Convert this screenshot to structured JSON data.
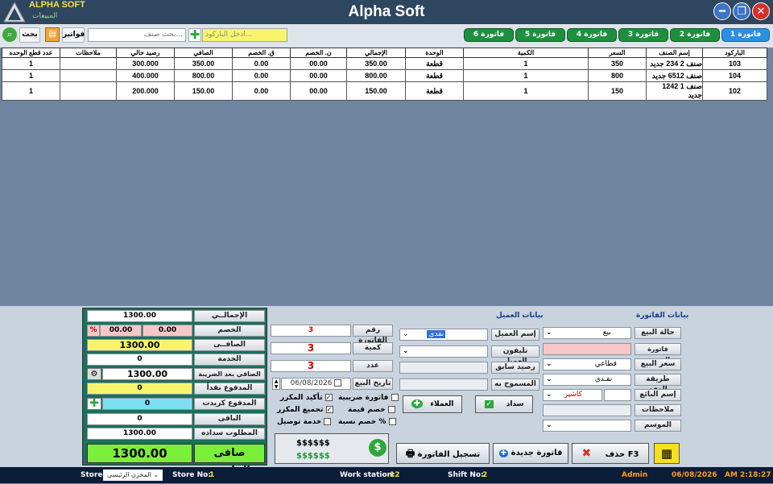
{
  "window": {
    "brand": "ALPHA SOFT",
    "brand_sub": "المبيعات",
    "title": "Alpha Soft"
  },
  "toolbar": {
    "search_label": "بحث",
    "invoices_label": "فواتير",
    "item_search_placeholder": "بحث صنف...",
    "barcode_placeholder": "ادخل الباركود..."
  },
  "tabs": [
    "فاتورة 1",
    "فاتورة 2",
    "فاتورة 3",
    "فاتورة 4",
    "فاتورة 5",
    "فاتورة 6"
  ],
  "table": {
    "headers": [
      "الباركود",
      "إسم الصنف",
      "السعر",
      "الكمية",
      "الوحدة",
      "الإجمالي",
      "ن. الخصم",
      "ق. الخصم",
      "الصافي",
      "رصيد حالي",
      "ملاحظات",
      "عدد قطع الوحده"
    ],
    "rows": [
      [
        "103",
        "صنف 2 234 جديد",
        "350",
        "1",
        "قطعة",
        "350.00",
        "00.00",
        "0.00",
        "350.00",
        "300.000",
        "",
        "1"
      ],
      [
        "104",
        "صنف 6512 جديد",
        "800",
        "1",
        "قطعة",
        "800.00",
        "00.00",
        "0.00",
        "800.00",
        "400.000",
        "",
        "1"
      ],
      [
        "102",
        "صنف 1 1242 جديد",
        "150",
        "1",
        "قطعة",
        "150.00",
        "00.00",
        "0.00",
        "150.00",
        "200.000",
        "",
        "1"
      ]
    ]
  },
  "totals": {
    "total_label": "الإجمالــي",
    "total": "1300.00",
    "discount_label": "الخصم",
    "discount_pct_sign": "%",
    "discount_a": "00.00",
    "discount_b": "0.00",
    "net_label": "الصافــى",
    "net": "1300.00",
    "service_label": "الخدمة",
    "service": "0",
    "after_tax_label": "الصافي بعد الضريبة",
    "after_tax": "1300.00",
    "paid_cash_label": "المدفوع نقداً",
    "paid_cash": "0",
    "paid_credit_label": "المدفوع كريدت",
    "paid_credit": "0",
    "remaining_label": "الباقى",
    "remaining": "0",
    "required_label": "المطلوب سداده",
    "required": "1300.00",
    "invoice_net_label": "صافى الفاتورة",
    "invoice_net": "1300.00"
  },
  "invoice_meta": {
    "number_label": "رقم الفاتورة",
    "number": "3",
    "qty_label": "كمية",
    "qty": "3",
    "count_label": "عدد",
    "count": "3",
    "date_label": "تاريخ البيع",
    "date": "06/08/2026",
    "opts": [
      "فاتورة ضريبية",
      "خصم قيمة",
      "خصم نسبة %"
    ],
    "opts2": [
      "تأكيد المكرر",
      "تجميع المكرر",
      "خدمة توصيل"
    ],
    "money1": "$$$$$$",
    "money2": "$$$$$$"
  },
  "customer": {
    "title": "بيانات العميل",
    "name_label": "إسم العميل",
    "name_value": "نقدى",
    "phone_label": "تليفون العميل",
    "prev_balance_label": "رصيد سابق",
    "allowed_label": "المسموح به",
    "pay_label": "سداد",
    "clients_label": "العملاء"
  },
  "invoice_data": {
    "title": "بيانات الفاتورة",
    "sale_state_label": "حالة البيع",
    "sale_state": "بيع",
    "returned_label": "فاتورة المرتجع",
    "price_label": "سعر البيع",
    "price": "قطاعي",
    "pay_method_label": "طريقة الدفع",
    "pay_method": "نقـدي",
    "seller_label": "إسم البائع",
    "seller": "كاشير",
    "notes_label": "ملاحظات",
    "season_label": "الموسم"
  },
  "actions": {
    "save": "تسجيل الفاتورة F12",
    "new": "فاتورة جديدة F4",
    "delete": "حذف F3"
  },
  "status": {
    "store_label": "Store:",
    "store": "المخزن الرئيسي",
    "store_no_label": "Store No:",
    "store_no": "1",
    "ws_label": "Work station:",
    "ws": "12",
    "shift_label": "Shift No:",
    "shift": "2",
    "user": "Admin",
    "date": "06/08/2026",
    "time": "AM 2:18:27"
  },
  "colors": {
    "tab": "#1e8f3f",
    "tab_active": "#2e8fe0",
    "title_bar": "#2e4660",
    "status_bar": "#0b1c38"
  }
}
